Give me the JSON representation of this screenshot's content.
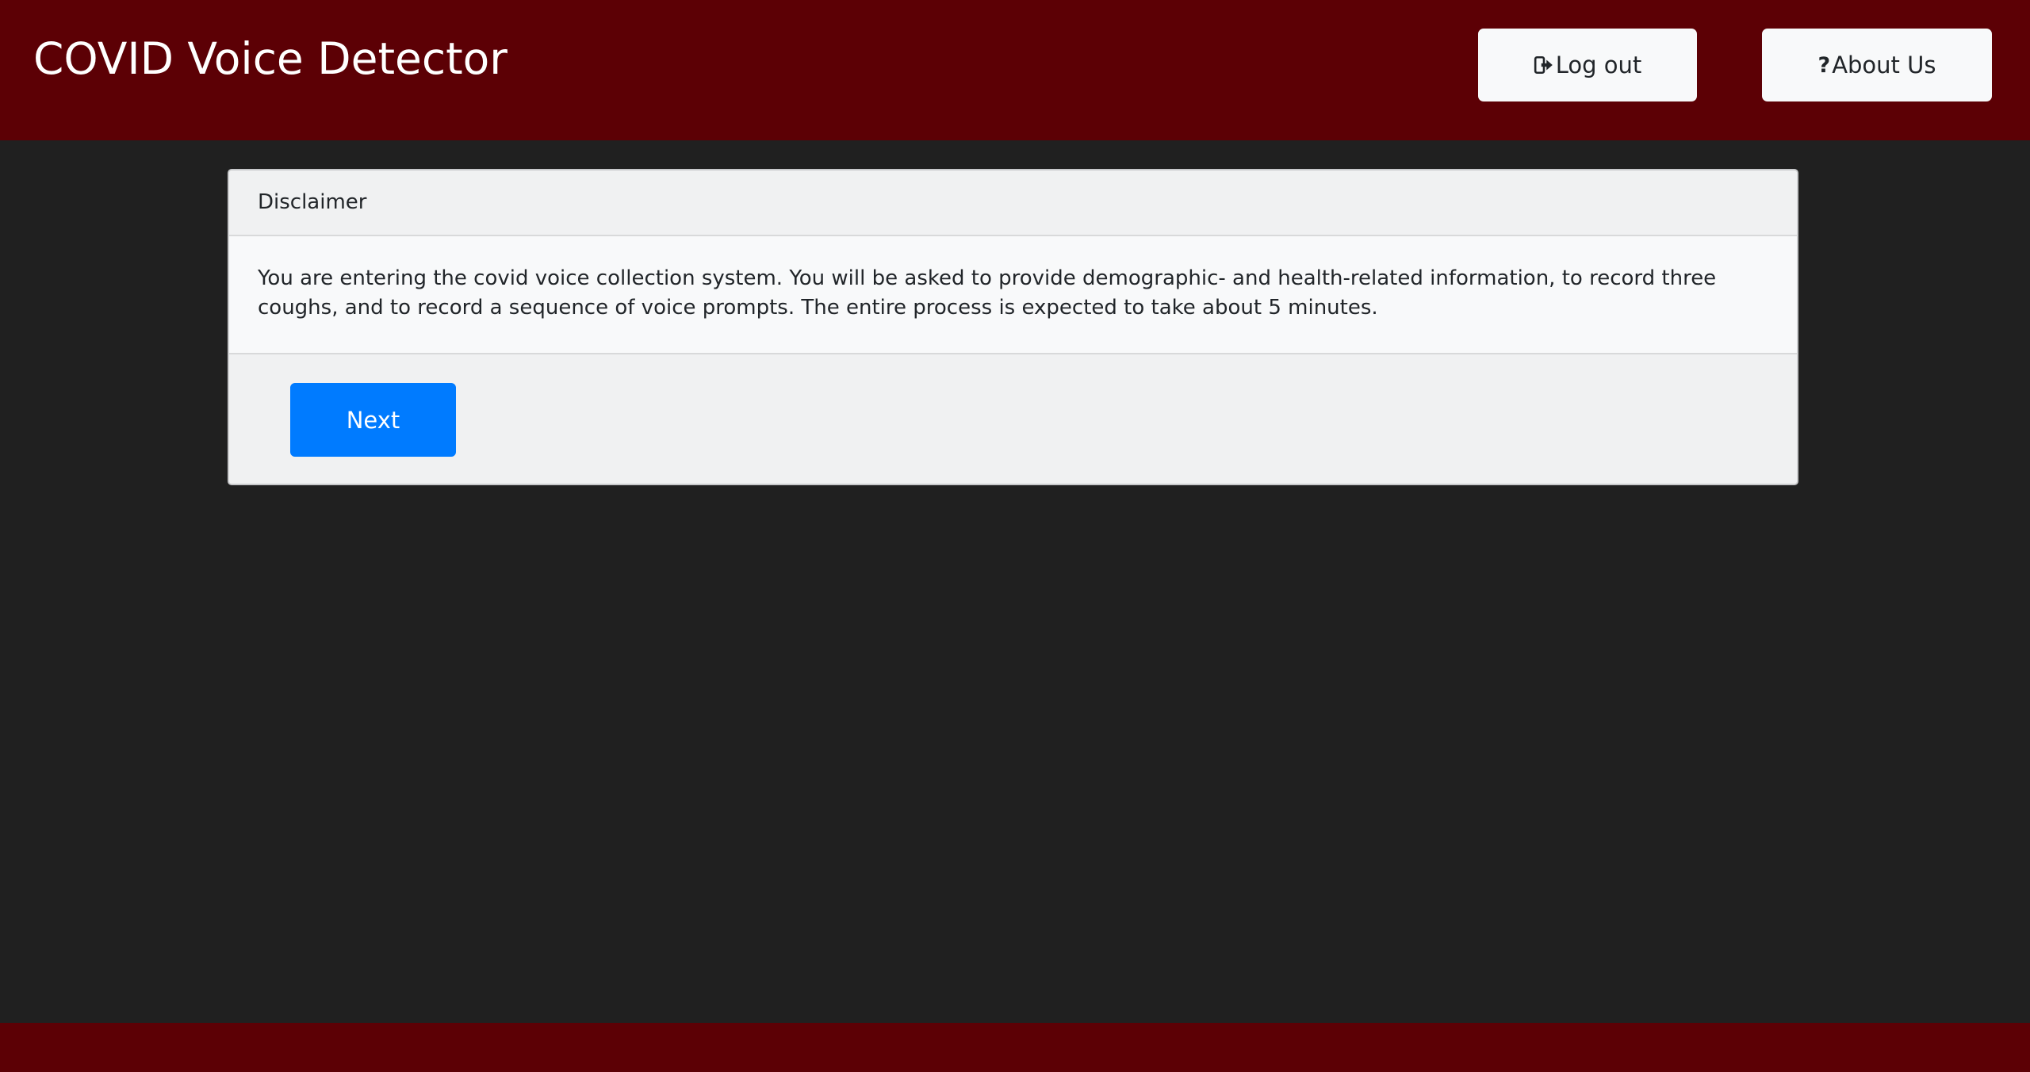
{
  "header": {
    "title": "COVID Voice Detector",
    "logout_label": "Log out",
    "logout_icon": "sign-out-icon",
    "about_label": "About Us",
    "about_icon": "question-icon",
    "about_icon_glyph": "?"
  },
  "disclaimer_card": {
    "header": "Disclaimer",
    "body": "You are entering the covid voice collection system. You will be asked to provide demographic- and health-related information, to record three coughs, and to record a sequence of voice prompts. The entire process is expected to take about 5 minutes.",
    "next_label": "Next"
  },
  "colors": {
    "brand": "#5c0005",
    "background": "#202020",
    "primary_button": "#007bff",
    "header_button": "#f8f9fa"
  }
}
